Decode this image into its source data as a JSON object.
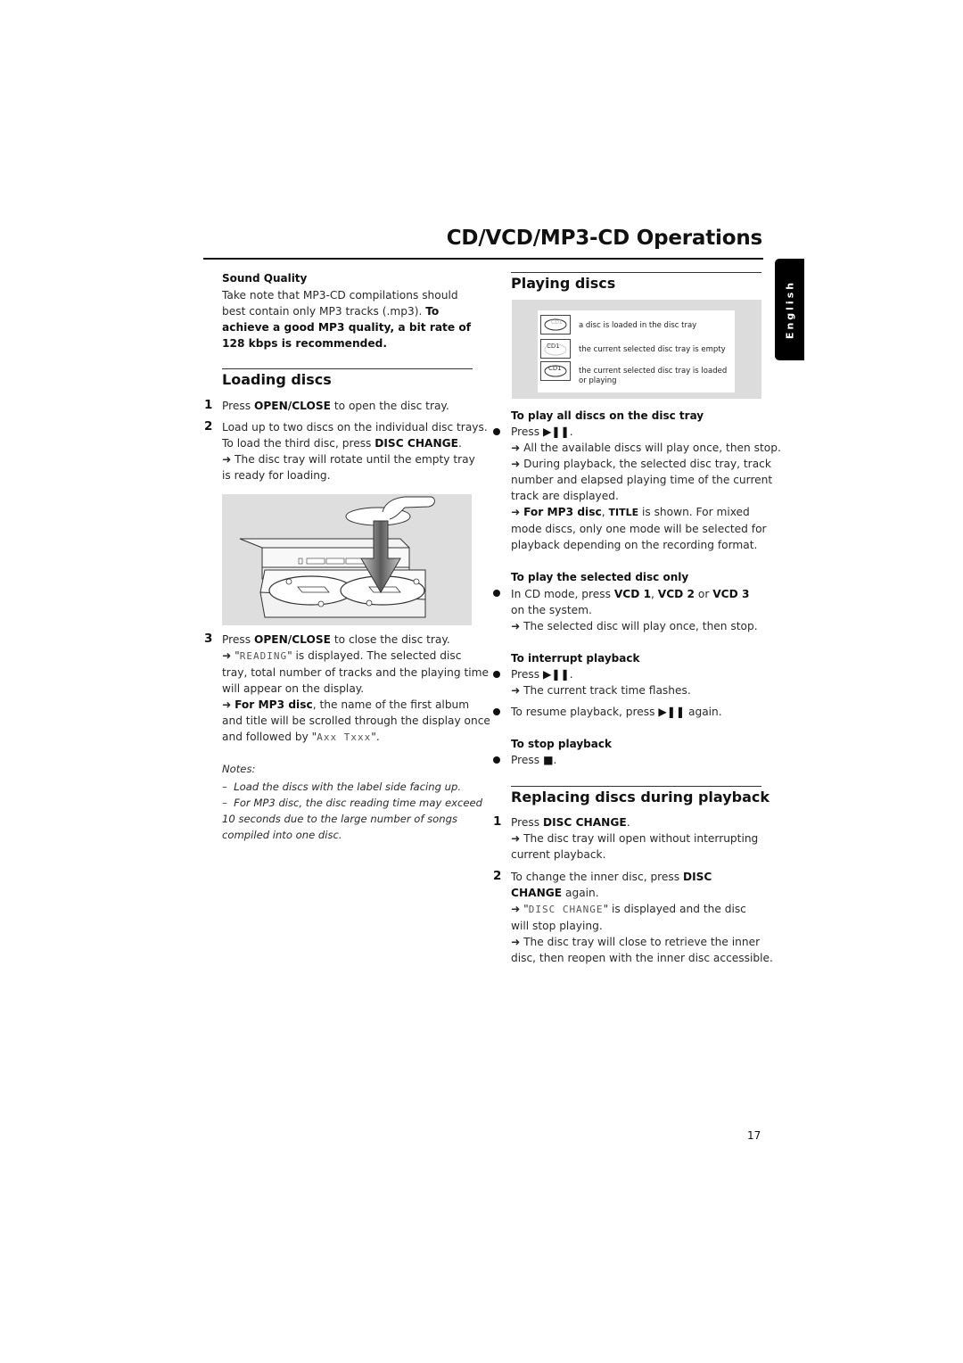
{
  "header": {
    "title": "CD/VCD/MP3-CD Operations",
    "language_tab": "English"
  },
  "left": {
    "sound_quality": {
      "heading": "Sound Quality",
      "text_plain": "Take note that MP3-CD compilations should best contain only MP3 tracks (.mp3).",
      "text_bold": "To achieve a good MP3 quality, a bit rate of 128 kbps is recommended.",
      "lines": [
        "Take note that MP3-CD compilations should",
        "best contain only MP3 tracks (.mp3).",
        "achieve a good MP3 quality, a bit rate of",
        "128 kbps is recommended."
      ],
      "to_label": "To"
    },
    "loading": {
      "heading": "Loading discs",
      "steps": [
        {
          "num": "1",
          "pre": "Press ",
          "key": "OPEN/CLOSE",
          "post": " to open the disc tray."
        },
        {
          "num": "2",
          "line1": "Load up to two discs on the individual disc trays.",
          "line2_pre": "To load the third disc, press ",
          "line2_key": "DISC CHANGE",
          "line2_post": ".",
          "result_line1": "The disc tray will rotate until the empty tray",
          "result_line2": "is ready for loading."
        },
        {
          "num": "3",
          "pre": "Press ",
          "key": "OPEN/CLOSE",
          "post": " to close the disc tray.",
          "lcd_reading": "READING",
          "r1_post": "\" is displayed. The selected disc",
          "r1_line2": "tray, total number of tracks and the playing time",
          "r1_line3": "will appear on the display.",
          "r2_bold": "For MP3 disc",
          "r2_post": ", the name of the first album",
          "r2_line2": "and title will be scrolled through the display once",
          "r2_line3_pre": "and followed by \"",
          "lcd_axx": "Axx Txxx",
          "r2_line3_post": "\"."
        }
      ],
      "illustration_alt": "hand-loading-disc-into-tray"
    },
    "notes": {
      "label": "Notes:",
      "items": [
        "Load the discs with the label side facing up.",
        "For MP3 disc, the disc reading time may exceed"
      ],
      "item2_line2": "10 seconds due to the large number of songs",
      "item2_line3": "compiled into one disc."
    }
  },
  "right": {
    "playing": {
      "heading": "Playing discs",
      "legend": [
        {
          "icon": "cd1-disc-loaded-icon",
          "icon_text": "CD1",
          "label": "a disc is loaded in the disc tray"
        },
        {
          "icon": "cd1-empty-icon",
          "icon_text": "CD1",
          "label": "the current selected disc tray is empty"
        },
        {
          "icon": "cd1-loaded-playing-icon",
          "icon_text": "CD1",
          "label": "the current selected disc tray is loaded",
          "label2": "or playing"
        }
      ],
      "play_all": {
        "heading": "To play all discs on the disc tray",
        "press": "Press",
        "key_symbol": "▶❚❚",
        "results": [
          "All the available discs will play once, then stop.",
          "During playback, the selected disc tray, track",
          "number and elapsed playing time of the current",
          "track are displayed."
        ],
        "mp3_bold": "For MP3 disc",
        "mp3_title": "TITLE",
        "mp3_post": " is shown.  For mixed",
        "mp3_line2": "mode discs, only one mode will be selected for",
        "mp3_line3": "playback depending on the recording format."
      },
      "play_selected": {
        "heading": "To play the selected disc only",
        "pre": "In CD mode, press ",
        "k1": "VCD 1",
        "sep1": ", ",
        "k2": "VCD 2",
        "sep2": " or ",
        "k3": "VCD 3",
        "line2": "on the system.",
        "result": "The selected disc will play once, then stop."
      },
      "interrupt": {
        "heading": "To interrupt playback",
        "press": "Press",
        "key_symbol": "▶❚❚",
        "result": "The current track time flashes.",
        "resume_pre": "To resume playback, press ",
        "resume_post": " again."
      },
      "stop": {
        "heading": "To stop playback",
        "press": "Press",
        "key_symbol": "■"
      }
    },
    "replacing": {
      "heading": "Replacing discs during playback",
      "step1_num": "1",
      "step1_pre": "Press ",
      "step1_key": "DISC CHANGE",
      "step1_post": ".",
      "step1_r1": "The disc tray will open without interrupting",
      "step1_r2": "current playback.",
      "step2_num": "2",
      "step2_pre": "To change the inner disc, press ",
      "step2_key1": "DISC",
      "step2_key2": "CHANGE",
      "step2_post": " again.",
      "lcd_disc_change": "DISC CHANGE",
      "step2_r1_post": "\" is displayed and the disc",
      "step2_r1_line2": "will stop playing.",
      "step2_r2": "The disc tray will close to retrieve the inner",
      "step2_r2_line2": "disc, then reopen with the inner disc accessible."
    }
  },
  "footer": {
    "page_number": "17"
  },
  "symbols": {
    "arrow": "➜",
    "dash": "–",
    "quote": "\""
  }
}
